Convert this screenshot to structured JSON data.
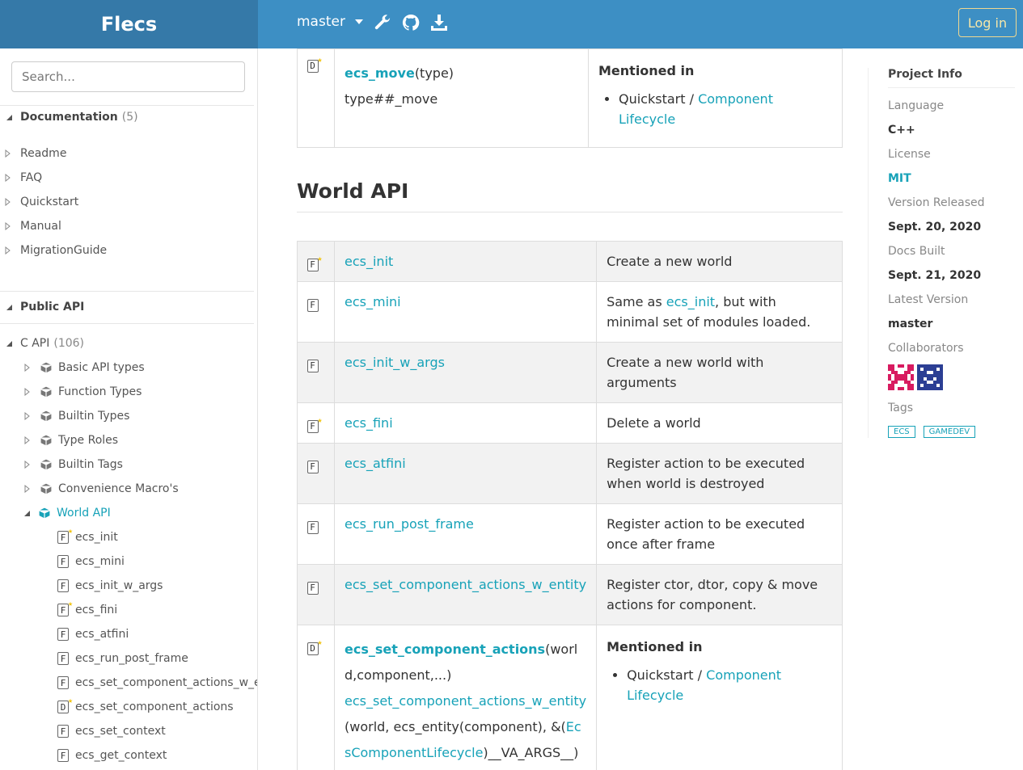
{
  "header": {
    "brand": "Flecs",
    "branch": "master",
    "login": "Log in"
  },
  "sidebar": {
    "search_placeholder": "Search...",
    "documentation": {
      "label": "Documentation",
      "count": "(5)"
    },
    "docs": [
      "Readme",
      "FAQ",
      "Quickstart",
      "Manual",
      "MigrationGuide"
    ],
    "public_api": "Public API",
    "c_api": {
      "label": "C API",
      "count": "(106)"
    },
    "groups": [
      "Basic API types",
      "Function Types",
      "Builtin Types",
      "Type Roles",
      "Builtin Tags",
      "Convenience Macro's",
      "World API"
    ],
    "world_items": [
      {
        "badge": "F",
        "star": true,
        "label": "ecs_init"
      },
      {
        "badge": "F",
        "star": false,
        "label": "ecs_mini"
      },
      {
        "badge": "F",
        "star": false,
        "label": "ecs_init_w_args"
      },
      {
        "badge": "F",
        "star": true,
        "label": "ecs_fini"
      },
      {
        "badge": "F",
        "star": false,
        "label": "ecs_atfini"
      },
      {
        "badge": "F",
        "star": false,
        "label": "ecs_run_post_frame"
      },
      {
        "badge": "F",
        "star": false,
        "label": "ecs_set_component_actions_w_er"
      },
      {
        "badge": "D",
        "star": true,
        "label": "ecs_set_component_actions"
      },
      {
        "badge": "F",
        "star": false,
        "label": "ecs_set_context"
      },
      {
        "badge": "F",
        "star": false,
        "label": "ecs_get_context"
      }
    ]
  },
  "top_row": {
    "badge": "D",
    "name": "ecs_move",
    "args": "(type)",
    "expansion": "type##_move",
    "mentioned_title": "Mentioned in",
    "mentioned_prefix": "Quickstart / ",
    "mentioned_link": "Component Lifecycle"
  },
  "section": {
    "title": "World API"
  },
  "rows": [
    {
      "badge": "F",
      "star": true,
      "name": "ecs_init",
      "desc": "Create a new world"
    },
    {
      "badge": "F",
      "star": false,
      "name": "ecs_mini",
      "desc_prefix": "Same as ",
      "desc_link": "ecs_init",
      "desc_suffix": ", but with minimal set of modules loaded."
    },
    {
      "badge": "F",
      "star": false,
      "name": "ecs_init_w_args",
      "desc": "Create a new world with arguments"
    },
    {
      "badge": "F",
      "star": true,
      "name": "ecs_fini",
      "desc": "Delete a world"
    },
    {
      "badge": "F",
      "star": false,
      "name": "ecs_atfini",
      "desc": "Register action to be executed when world is destroyed"
    },
    {
      "badge": "F",
      "star": false,
      "name": "ecs_run_post_frame",
      "desc": "Register action to be executed once after frame"
    },
    {
      "badge": "F",
      "star": false,
      "name": "ecs_set_component_actions_w_entity",
      "desc": "Register ctor, dtor, copy & move actions for component."
    }
  ],
  "macro_row": {
    "badge": "D",
    "name": "ecs_set_component_actions",
    "args": "(world,component,...)",
    "expansion_link": "ecs_set_component_actions_w_entity",
    "expansion_mid": "(world, ecs_entity(component), &(",
    "expansion_link2": "EcsComponentLifecycle",
    "expansion_end": ")__VA_ARGS__)",
    "mentioned_title": "Mentioned in",
    "mentioned_prefix": "Quickstart / ",
    "mentioned_link": "Component Lifecycle"
  },
  "info": {
    "title": "Project Info",
    "language_label": "Language",
    "language": "C++",
    "license_label": "License",
    "license": "MIT",
    "released_label": "Version Released",
    "released": "Sept. 20, 2020",
    "built_label": "Docs Built",
    "built": "Sept. 21, 2020",
    "latest_label": "Latest Version",
    "latest": "master",
    "collab_label": "Collaborators",
    "tags_label": "Tags",
    "tags": [
      "ECS",
      "GAMEDEV"
    ]
  },
  "colors": {
    "header": "#3d8fc4",
    "brand_bg": "#3579a8",
    "link": "#17a2b8",
    "login": "#f7e7a8"
  }
}
